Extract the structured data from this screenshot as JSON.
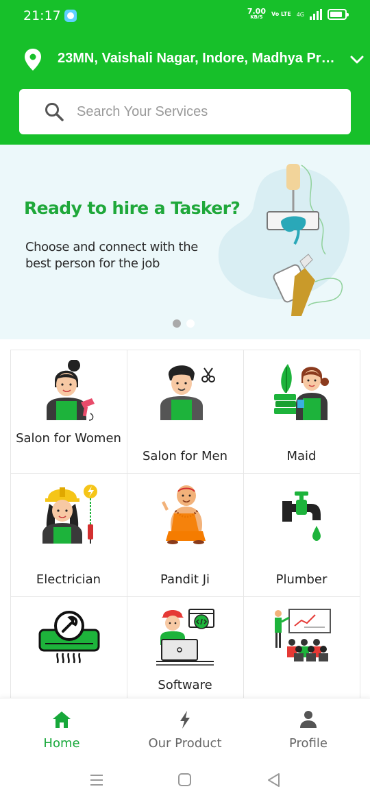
{
  "status_bar": {
    "time": "21:17",
    "net_speed_value": "7.00",
    "net_speed_unit": "KB/S",
    "volte": "Vo LTE",
    "network": "4G"
  },
  "location": {
    "address": "23MN, Vaishali Nagar, Indore, Madhya Prad..."
  },
  "search": {
    "placeholder": "Search Your Services"
  },
  "banner": {
    "title": "Ready to hire a Tasker?",
    "subtitle": "Choose and connect with the best person for the job",
    "slide_count": 2,
    "active_slide": 1
  },
  "categories": [
    {
      "label": "Salon for Women",
      "icon": "woman-hairdryer-icon"
    },
    {
      "label": "Salon for Men",
      "icon": "man-scissors-icon"
    },
    {
      "label": "Maid",
      "icon": "maid-icon"
    },
    {
      "label": "Electrician",
      "icon": "electrician-icon"
    },
    {
      "label": "Pandit Ji",
      "icon": "pandit-icon"
    },
    {
      "label": "Plumber",
      "icon": "tap-icon"
    },
    {
      "label": "",
      "icon": "ac-repair-icon"
    },
    {
      "label": "Software",
      "icon": "software-developer-icon"
    },
    {
      "label": "",
      "icon": "presentation-icon"
    }
  ],
  "bottom_nav": [
    {
      "label": "Home",
      "icon": "home-icon",
      "active": true
    },
    {
      "label": "Our Product",
      "icon": "lightning-icon",
      "active": false
    },
    {
      "label": "Profile",
      "icon": "person-icon",
      "active": false
    }
  ],
  "colors": {
    "brand_green": "#17c02a",
    "accent_green": "#1fa83a",
    "banner_bg": "#ecf8fa"
  }
}
